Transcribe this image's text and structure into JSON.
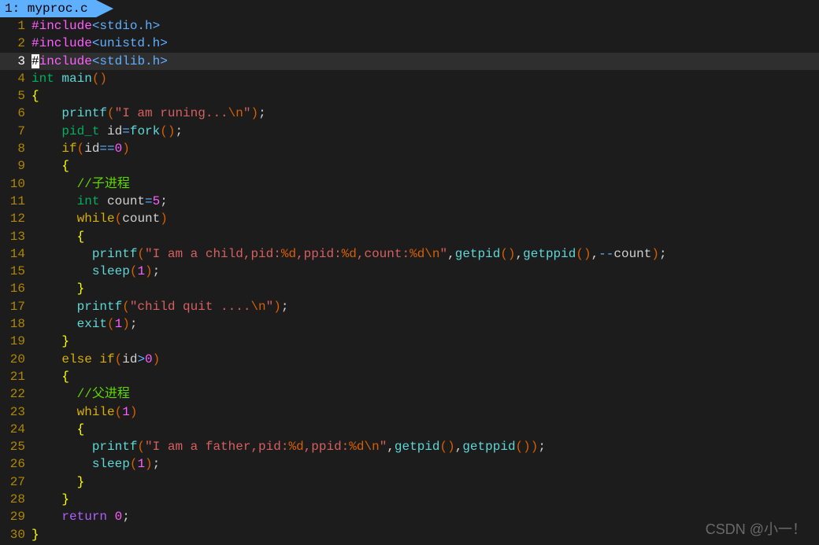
{
  "tab": {
    "label": "1: myproc.c"
  },
  "watermark": "CSDN @小一！",
  "lines": [
    {
      "n": "1",
      "html": "<span class='preproc'>#include</span><span class='angle'>&lt;stdio.h&gt;</span>"
    },
    {
      "n": "2",
      "html": "<span class='preproc'>#include</span><span class='angle'>&lt;unistd.h&gt;</span>"
    },
    {
      "n": "3",
      "current": true,
      "html": "<span class='cursor'>#</span><span class='preproc'>include</span><span class='angle'>&lt;stdlib.h&gt;</span>"
    },
    {
      "n": "4",
      "html": "<span class='type'>int</span> <span class='func'>main</span><span class='paren'>()</span>"
    },
    {
      "n": "5",
      "html": "<span class='brace'>{</span>"
    },
    {
      "n": "6",
      "html": "    <span class='func'>printf</span><span class='paren'>(</span><span class='string'>\"I am runing...</span><span class='escape'>\\n</span><span class='string'>\"</span><span class='paren'>)</span>;"
    },
    {
      "n": "7",
      "html": "    <span class='type'>pid_t</span> id<span class='op'>=</span><span class='func'>fork</span><span class='paren'>()</span>;"
    },
    {
      "n": "8",
      "html": "    <span class='keyword'>if</span><span class='paren'>(</span>id<span class='op'>==</span><span class='number'>0</span><span class='paren'>)</span>"
    },
    {
      "n": "9",
      "html": "    <span class='brace'>{</span>"
    },
    {
      "n": "10",
      "html": "      <span class='comment'>//子进程</span>"
    },
    {
      "n": "11",
      "html": "      <span class='type'>int</span> count<span class='op'>=</span><span class='number'>5</span>;"
    },
    {
      "n": "12",
      "html": "      <span class='keyword'>while</span><span class='paren'>(</span>count<span class='paren'>)</span>"
    },
    {
      "n": "13",
      "html": "      <span class='brace'>{</span>"
    },
    {
      "n": "14",
      "html": "        <span class='func'>printf</span><span class='paren'>(</span><span class='string'>\"I am a child,pid:</span><span class='escape'>%d</span><span class='string'>,ppid:</span><span class='escape'>%d</span><span class='string'>,count:</span><span class='escape'>%d\\n</span><span class='string'>\"</span>,<span class='func'>getpid</span><span class='paren'>()</span>,<span class='func'>getppid</span><span class='paren'>()</span>,<span class='op'>--</span>count<span class='paren'>)</span>;"
    },
    {
      "n": "15",
      "html": "        <span class='func'>sleep</span><span class='paren'>(</span><span class='number'>1</span><span class='paren'>)</span>;"
    },
    {
      "n": "16",
      "html": "      <span class='brace'>}</span>"
    },
    {
      "n": "17",
      "html": "      <span class='func'>printf</span><span class='paren'>(</span><span class='string'>\"child quit ....</span><span class='escape'>\\n</span><span class='string'>\"</span><span class='paren'>)</span>;"
    },
    {
      "n": "18",
      "html": "      <span class='func'>exit</span><span class='paren'>(</span><span class='number'>1</span><span class='paren'>)</span>;"
    },
    {
      "n": "19",
      "html": "    <span class='brace'>}</span>"
    },
    {
      "n": "20",
      "html": "    <span class='keyword'>else</span> <span class='keyword'>if</span><span class='paren'>(</span>id<span class='op'>&gt;</span><span class='number'>0</span><span class='paren'>)</span>"
    },
    {
      "n": "21",
      "html": "    <span class='brace'>{</span>"
    },
    {
      "n": "22",
      "html": "      <span class='comment'>//父进程</span>"
    },
    {
      "n": "23",
      "html": "      <span class='keyword'>while</span><span class='paren'>(</span><span class='number'>1</span><span class='paren'>)</span>"
    },
    {
      "n": "24",
      "html": "      <span class='brace'>{</span>"
    },
    {
      "n": "25",
      "html": "        <span class='func'>printf</span><span class='paren'>(</span><span class='string'>\"I am a father,pid:</span><span class='escape'>%d</span><span class='string'>,ppid:</span><span class='escape'>%d\\n</span><span class='string'>\"</span>,<span class='func'>getpid</span><span class='paren'>()</span>,<span class='func'>getppid</span><span class='paren'>())</span>;"
    },
    {
      "n": "26",
      "html": "        <span class='func'>sleep</span><span class='paren'>(</span><span class='number'>1</span><span class='paren'>)</span>;"
    },
    {
      "n": "27",
      "html": "      <span class='brace'>}</span>"
    },
    {
      "n": "28",
      "html": "    <span class='brace'>}</span>"
    },
    {
      "n": "29",
      "html": "    <span class='return'>return</span> <span class='number'>0</span>;"
    },
    {
      "n": "30",
      "html": "<span class='brace'>}</span>"
    }
  ]
}
